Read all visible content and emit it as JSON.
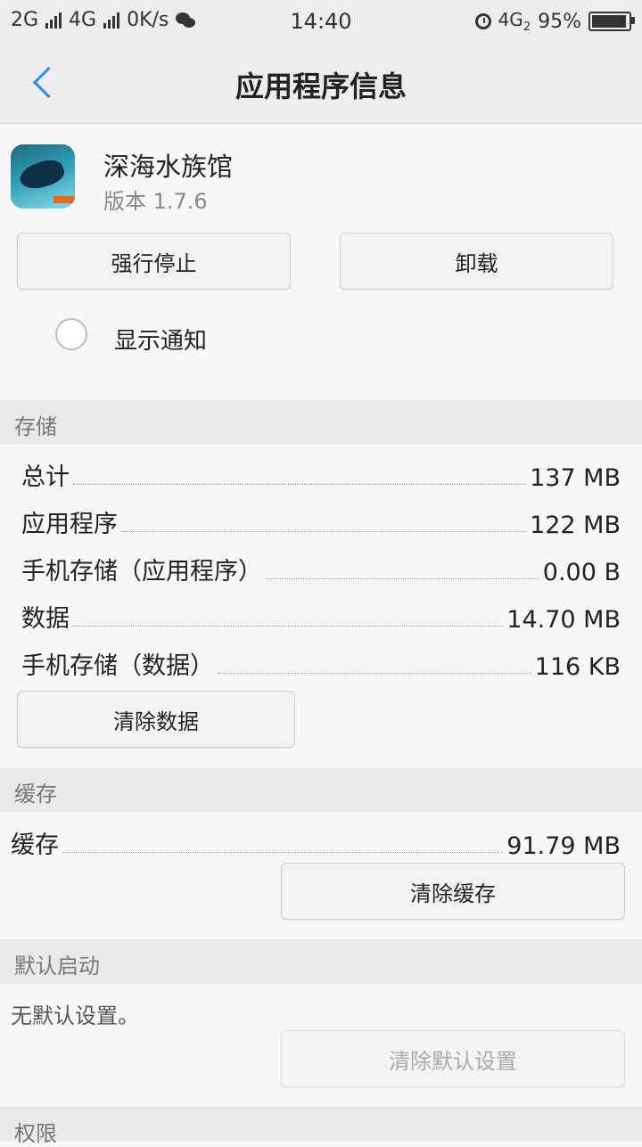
{
  "status_bar": {
    "sig1": "2G",
    "sig2": "4G",
    "speed": "0K/s",
    "time": "14:40",
    "net": "4G",
    "net_sub": "2",
    "battery": "95%"
  },
  "header": {
    "title": "应用程序信息"
  },
  "app": {
    "name": "深海水族馆",
    "version": "版本 1.7.6"
  },
  "buttons": {
    "force_stop": "强行停止",
    "uninstall": "卸载",
    "clear_data": "清除数据",
    "clear_cache": "清除缓存",
    "clear_defaults": "清除默认设置"
  },
  "notification": {
    "label": "显示通知"
  },
  "storage": {
    "header": "存储",
    "rows": [
      {
        "label": "总计",
        "value": "137 MB"
      },
      {
        "label": "应用程序",
        "value": "122 MB"
      },
      {
        "label": "手机存储（应用程序）",
        "value": "0.00 B"
      },
      {
        "label": "数据",
        "value": "14.70 MB"
      },
      {
        "label": "手机存储（数据）",
        "value": "116 KB"
      }
    ]
  },
  "cache": {
    "header": "缓存",
    "label": "缓存",
    "value": "91.79 MB"
  },
  "default_launch": {
    "header": "默认启动",
    "text": "无默认设置。"
  },
  "permissions": {
    "header": "权限"
  }
}
